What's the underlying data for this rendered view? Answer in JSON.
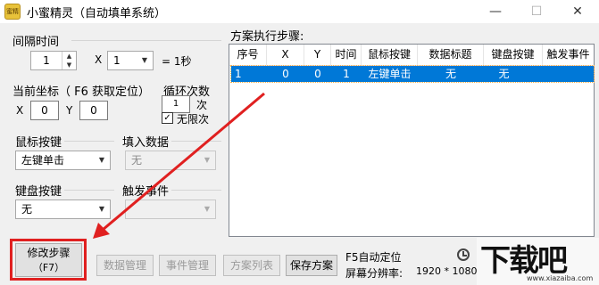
{
  "window": {
    "title": "小蜜精灵（自动填单系统）",
    "app_icon_text": "蜜精灵",
    "min_label": "—",
    "max_label": "☐",
    "close_label": "✕"
  },
  "interval": {
    "label": "间隔时间",
    "value": "1",
    "multiplier_label": "X",
    "multiplier_value": "1",
    "equals_label": "= 1秒"
  },
  "coords": {
    "label": "当前坐标（ F6 获取定位）",
    "x_label": "X",
    "x_value": "0",
    "y_label": "Y",
    "y_value": "0"
  },
  "loop": {
    "label": "循环次数",
    "value": "1",
    "unit": "次",
    "unlimited_label": "无限次",
    "unlimited_checked": true
  },
  "mouse": {
    "label": "鼠标按键",
    "value": "左键单击"
  },
  "fill": {
    "label": "填入数据",
    "value": "无"
  },
  "keyboard": {
    "label": "键盘按键",
    "value": "无"
  },
  "trigger": {
    "label": "触发事件",
    "value": ""
  },
  "steps": {
    "label": "方案执行步骤:",
    "columns": [
      "序号",
      "X",
      "Y",
      "时间",
      "鼠标按键",
      "数据标题",
      "键盘按键",
      "触发事件"
    ],
    "rows": [
      [
        "1",
        "0",
        "0",
        "1",
        "左键单击",
        "无",
        "无",
        ""
      ]
    ]
  },
  "buttons": {
    "modify_line1": "修改步骤",
    "modify_line2": "（F7）",
    "data_manage": "数据管理",
    "event_manage": "事件管理",
    "plan_list": "方案列表",
    "save_plan": "保存方案"
  },
  "status": {
    "f5_label": "F5自动定位",
    "resolution_label": "屏幕分辨率:",
    "resolution_value": "1920 * 1080"
  },
  "watermark": {
    "main": "下载吧",
    "url": "www.xiazaiba.com"
  },
  "colors": {
    "selection": "#0078d7",
    "highlight": "#e02020"
  }
}
